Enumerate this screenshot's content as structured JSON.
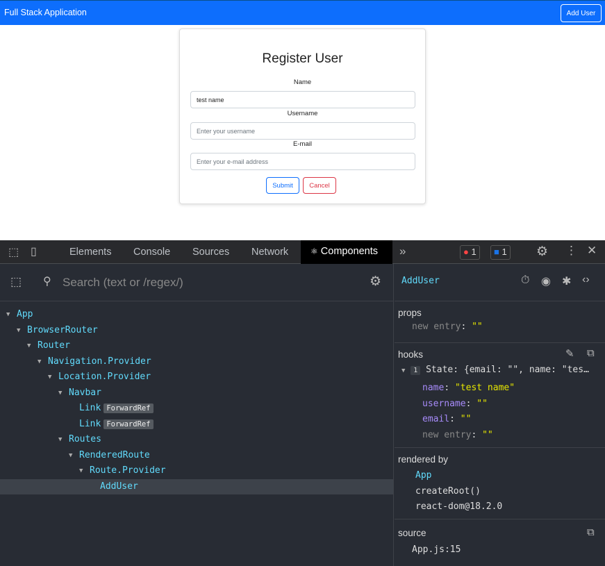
{
  "app": {
    "brand": "Full Stack Application",
    "add_user_button": "Add User",
    "form": {
      "title": "Register User",
      "name_label": "Name",
      "name_value": "test name",
      "username_label": "Username",
      "username_placeholder": "Enter your username",
      "email_label": "E-mail",
      "email_placeholder": "Enter your e-mail address",
      "submit": "Submit",
      "cancel": "Cancel"
    }
  },
  "devtools": {
    "tabs": [
      "Elements",
      "Console",
      "Sources",
      "Network",
      "Components"
    ],
    "active_tab": "Components",
    "error_count": "1",
    "message_count": "1",
    "search_placeholder": "Search (text or /regex/)",
    "tree": [
      {
        "name": "App",
        "depth": 0,
        "expanded": true
      },
      {
        "name": "BrowserRouter",
        "depth": 1,
        "expanded": true
      },
      {
        "name": "Router",
        "depth": 2,
        "expanded": true
      },
      {
        "name": "Navigation.Provider",
        "depth": 3,
        "expanded": true
      },
      {
        "name": "Location.Provider",
        "depth": 4,
        "expanded": true
      },
      {
        "name": "Navbar",
        "depth": 5,
        "expanded": true
      },
      {
        "name": "Link",
        "depth": 6,
        "badge": "ForwardRef"
      },
      {
        "name": "Link",
        "depth": 6,
        "badge": "ForwardRef"
      },
      {
        "name": "Routes",
        "depth": 5,
        "expanded": true
      },
      {
        "name": "RenderedRoute",
        "depth": 6,
        "expanded": true
      },
      {
        "name": "Route.Provider",
        "depth": 7,
        "expanded": true
      },
      {
        "name": "AddUser",
        "depth": 8,
        "selected": true
      }
    ],
    "inspector": {
      "component": "AddUser",
      "props_title": "props",
      "props_new_entry": "new entry",
      "empty": "\"\"",
      "hooks_title": "hooks",
      "hook_index": "1",
      "hook_summary": "State: {email: \"\", name: \"tes…",
      "hook_fields": [
        {
          "key": "name",
          "value": "\"test name\""
        },
        {
          "key": "username",
          "value": "\"\""
        },
        {
          "key": "email",
          "value": "\"\""
        }
      ],
      "rendered_by_title": "rendered by",
      "rendered_by": [
        "App",
        "createRoot()",
        "react-dom@18.2.0"
      ],
      "source_title": "source",
      "source": "App.js:15"
    }
  }
}
